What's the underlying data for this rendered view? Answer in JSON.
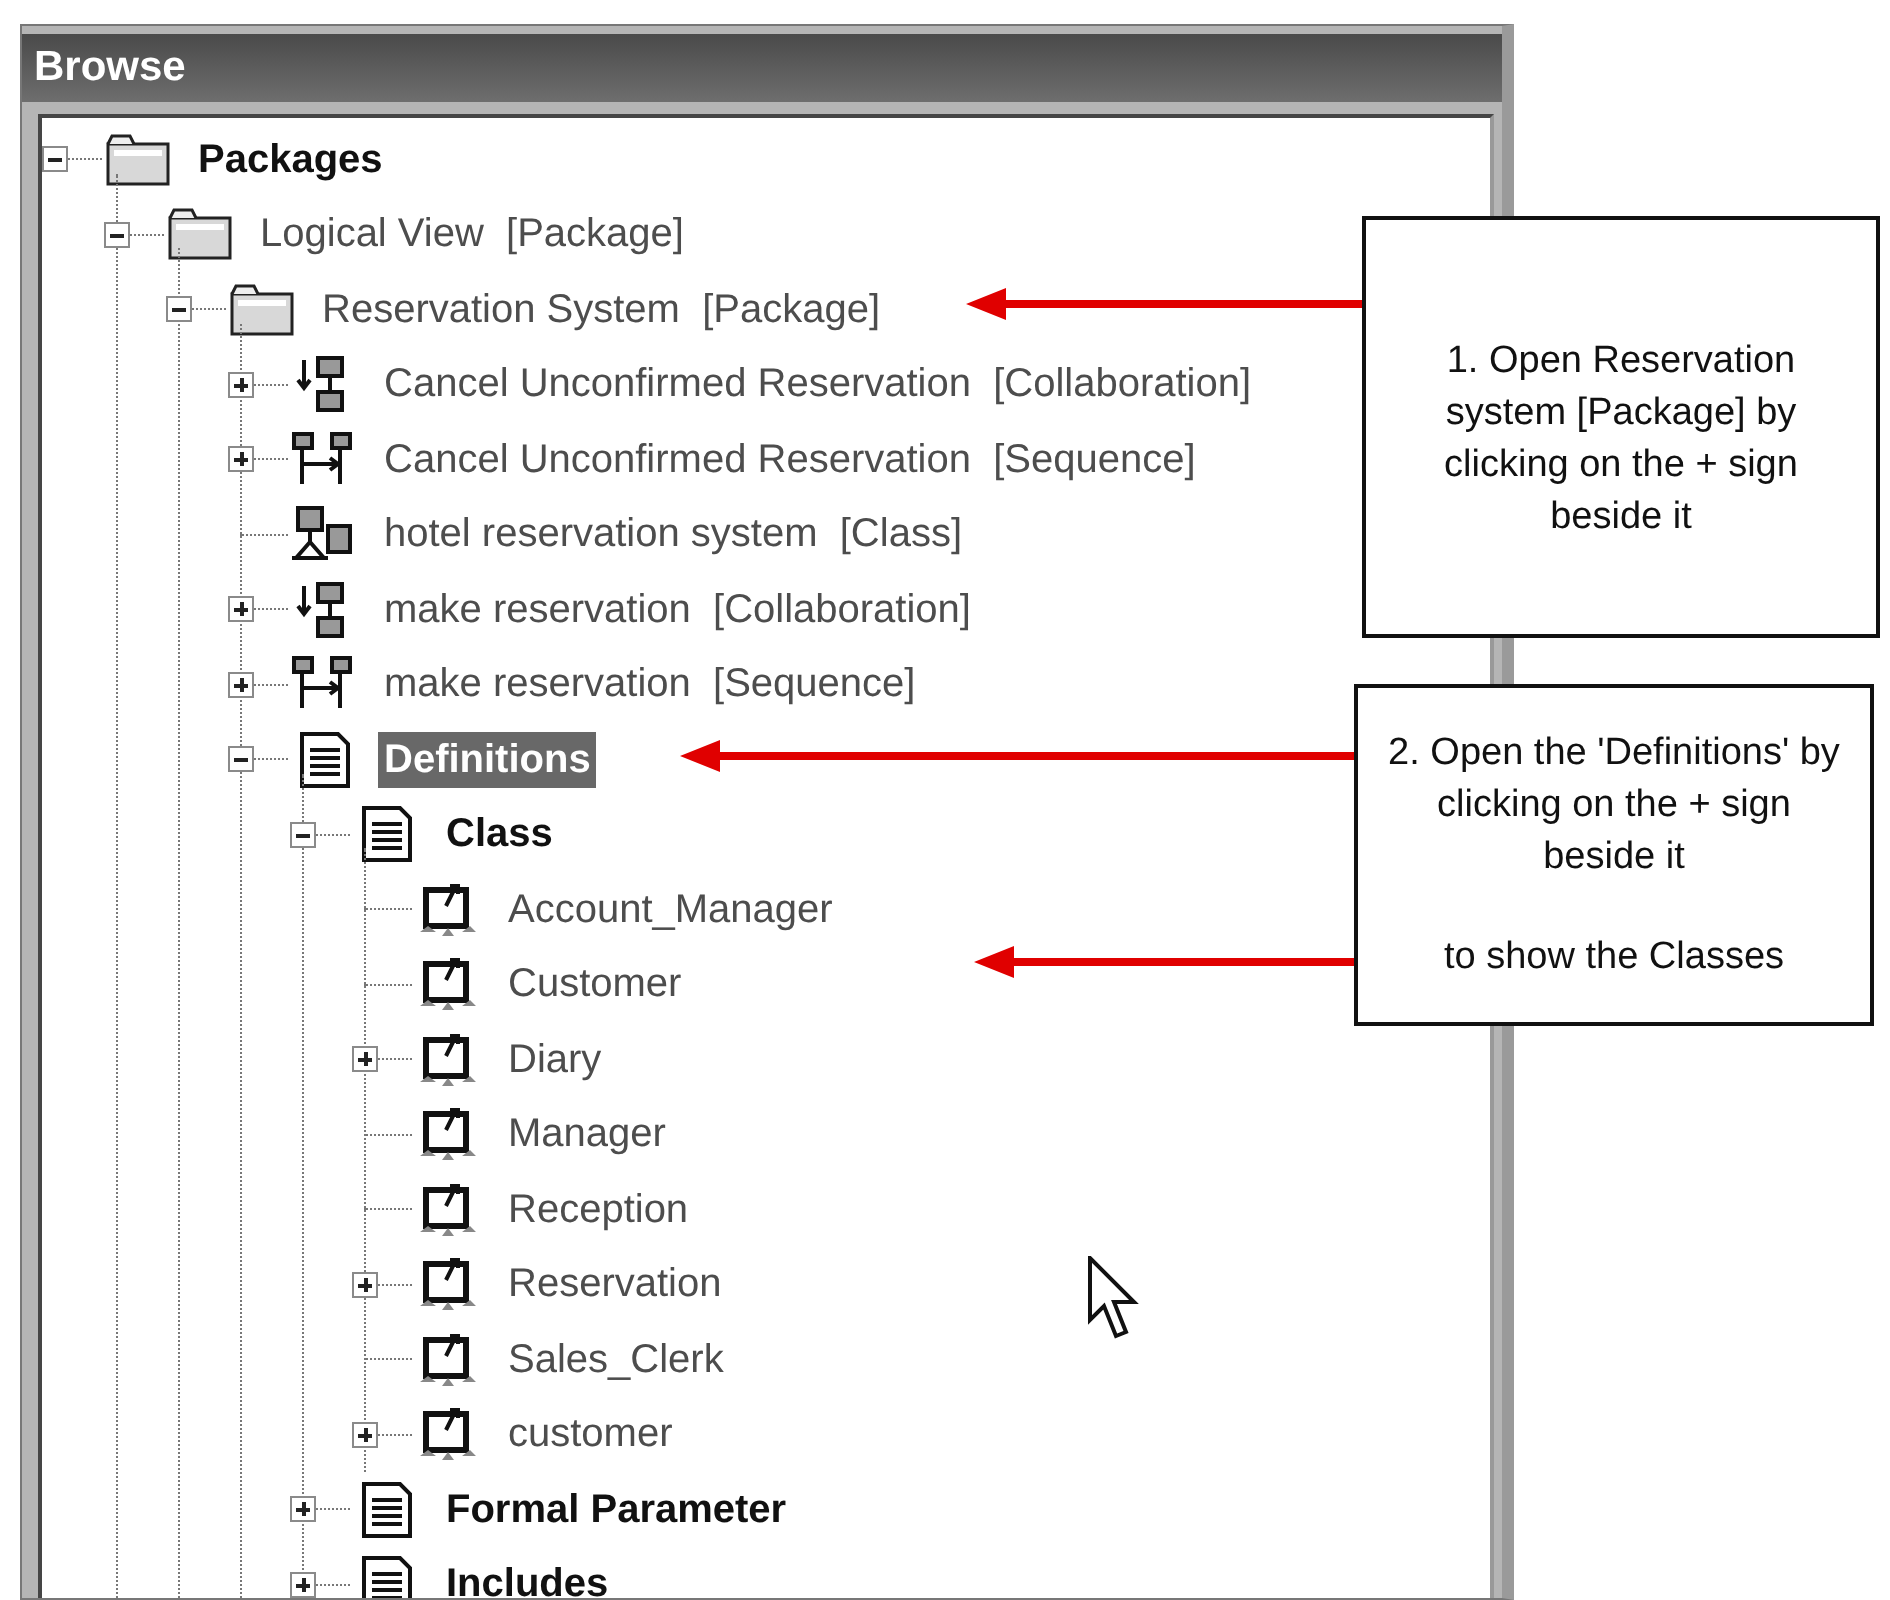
{
  "window": {
    "title": "Browse"
  },
  "tree": [
    {
      "label": "Packages",
      "kind": "folder",
      "bold": true,
      "selected": false,
      "expandable": true,
      "expanded": true,
      "children": [
        {
          "label": "Logical View  [Package]",
          "kind": "folder",
          "bold": false,
          "selected": false,
          "expandable": true,
          "expanded": true,
          "children": [
            {
              "label": "Reservation System  [Package]",
              "kind": "folder",
              "bold": false,
              "selected": false,
              "expandable": true,
              "expanded": true,
              "children": [
                {
                  "label": "Cancel Unconfirmed Reservation  [Collaboration]",
                  "kind": "collaboration",
                  "bold": false,
                  "selected": false,
                  "expandable": true,
                  "expanded": false
                },
                {
                  "label": "Cancel Unconfirmed Reservation  [Sequence]",
                  "kind": "sequence",
                  "bold": false,
                  "selected": false,
                  "expandable": true,
                  "expanded": false
                },
                {
                  "label": "hotel reservation system  [Class]",
                  "kind": "class-diagram",
                  "bold": false,
                  "selected": false,
                  "expandable": false
                },
                {
                  "label": "make reservation  [Collaboration]",
                  "kind": "collaboration",
                  "bold": false,
                  "selected": false,
                  "expandable": true,
                  "expanded": false
                },
                {
                  "label": "make reservation  [Sequence]",
                  "kind": "sequence",
                  "bold": false,
                  "selected": false,
                  "expandable": true,
                  "expanded": false
                },
                {
                  "label": "Definitions",
                  "kind": "definitions",
                  "bold": true,
                  "selected": true,
                  "expandable": true,
                  "expanded": true,
                  "children": [
                    {
                      "label": "Class",
                      "kind": "definitions",
                      "bold": true,
                      "selected": false,
                      "expandable": true,
                      "expanded": true,
                      "children": [
                        {
                          "label": "Account_Manager",
                          "kind": "class",
                          "bold": false,
                          "selected": false,
                          "expandable": false
                        },
                        {
                          "label": "Customer",
                          "kind": "class",
                          "bold": false,
                          "selected": false,
                          "expandable": false
                        },
                        {
                          "label": "Diary",
                          "kind": "class",
                          "bold": false,
                          "selected": false,
                          "expandable": true,
                          "expanded": false
                        },
                        {
                          "label": "Manager",
                          "kind": "class",
                          "bold": false,
                          "selected": false,
                          "expandable": false
                        },
                        {
                          "label": "Reception",
                          "kind": "class",
                          "bold": false,
                          "selected": false,
                          "expandable": false
                        },
                        {
                          "label": "Reservation",
                          "kind": "class",
                          "bold": false,
                          "selected": false,
                          "expandable": true,
                          "expanded": false
                        },
                        {
                          "label": "Sales_Clerk",
                          "kind": "class",
                          "bold": false,
                          "selected": false,
                          "expandable": false
                        },
                        {
                          "label": "customer",
                          "kind": "class",
                          "bold": false,
                          "selected": false,
                          "expandable": true,
                          "expanded": false
                        }
                      ]
                    },
                    {
                      "label": "Formal Parameter",
                      "kind": "definitions",
                      "bold": true,
                      "selected": false,
                      "expandable": true,
                      "expanded": false
                    },
                    {
                      "label": "Includes",
                      "kind": "definitions",
                      "bold": true,
                      "selected": false,
                      "expandable": true,
                      "expanded": false
                    }
                  ]
                }
              ]
            }
          ]
        }
      ]
    }
  ],
  "callouts": [
    {
      "paragraphs": [
        "1. Open Reservation system [Package] by clicking on the + sign beside it"
      ]
    },
    {
      "paragraphs": [
        "2. Open the 'Definitions' by clicking on the + sign beside it",
        "to show the Classes"
      ]
    }
  ]
}
